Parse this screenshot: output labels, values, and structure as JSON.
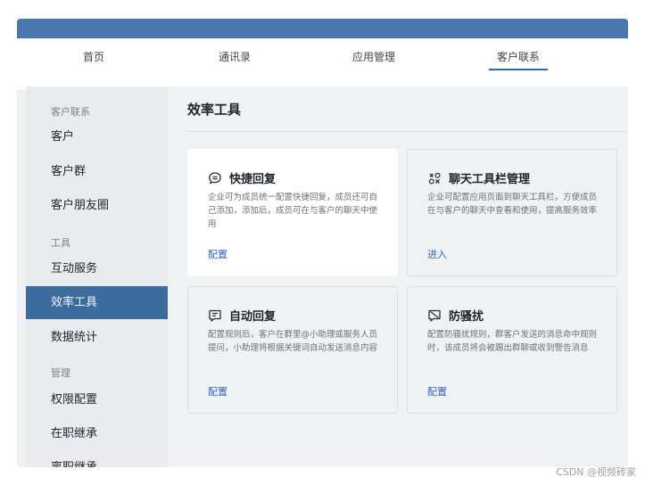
{
  "nav": {
    "items": [
      {
        "label": "首页"
      },
      {
        "label": "通讯录"
      },
      {
        "label": "应用管理"
      },
      {
        "label": "客户联系"
      }
    ],
    "active_label": "客户联系"
  },
  "sidebar": {
    "group_customers": "客户联系",
    "group_tools": "工具",
    "group_manage": "管理",
    "items": [
      {
        "label": "客户"
      },
      {
        "label": "客户群"
      },
      {
        "label": "客户朋友圈"
      },
      {
        "label": "互动服务"
      },
      {
        "label": "效率工具"
      },
      {
        "label": "数据统计"
      },
      {
        "label": "权限配置"
      },
      {
        "label": "在职继承"
      },
      {
        "label": "离职继承"
      }
    ],
    "active_label": "效率工具"
  },
  "main": {
    "title": "效率工具",
    "cards": [
      {
        "icon": "chat-bubble-icon",
        "title": "快捷回复",
        "desc": "企业可为成员统一配置快捷回复，成员还可自己添加，添加后，成员可在与客户的聊天中使用",
        "link": "配置"
      },
      {
        "icon": "toolbar-manage-icon",
        "title": "聊天工具栏管理",
        "desc": "企业可配置应用页面到聊天工具栏，方便成员在与客户的聊天中查看和使用，提高服务效率",
        "link": "进入"
      },
      {
        "icon": "auto-reply-icon",
        "title": "自动回复",
        "desc": "配置规则后，客户在群里@小助理或服务人员提问，小助理将根据关键词自动发送消息内容",
        "link": "配置"
      },
      {
        "icon": "anti-harassment-icon",
        "title": "防骚扰",
        "desc": "配置防骚扰规则，群客户发送的消息命中规则时，该成员将会被踢出群聊或收到警告消息",
        "link": "配置"
      }
    ]
  },
  "watermark": "CSDN @视频砖家",
  "colors": {
    "topbar": "#4a78ae",
    "accent": "#2b66c6",
    "sidebar_active": "#3c6b9d"
  }
}
